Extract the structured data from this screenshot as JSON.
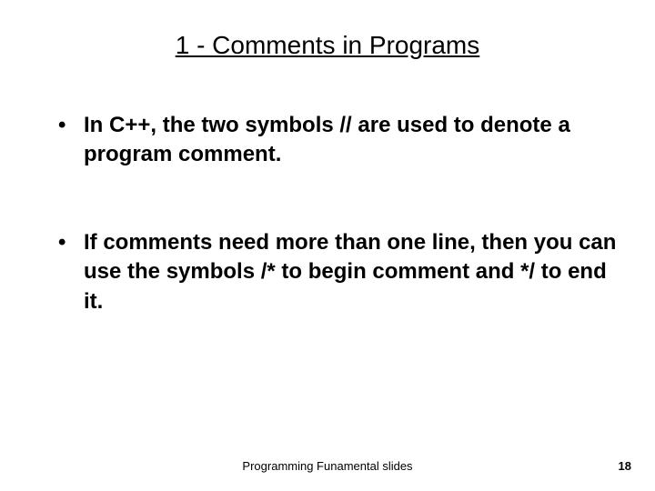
{
  "title": "1 - Comments in Programs",
  "bullets": [
    "In C++, the two symbols  // are used to denote a program comment.",
    "If comments need more than one line, then you can use the symbols  /* to begin comment and */ to end it."
  ],
  "footer": {
    "center": "Programming Funamental slides",
    "page": "18"
  }
}
